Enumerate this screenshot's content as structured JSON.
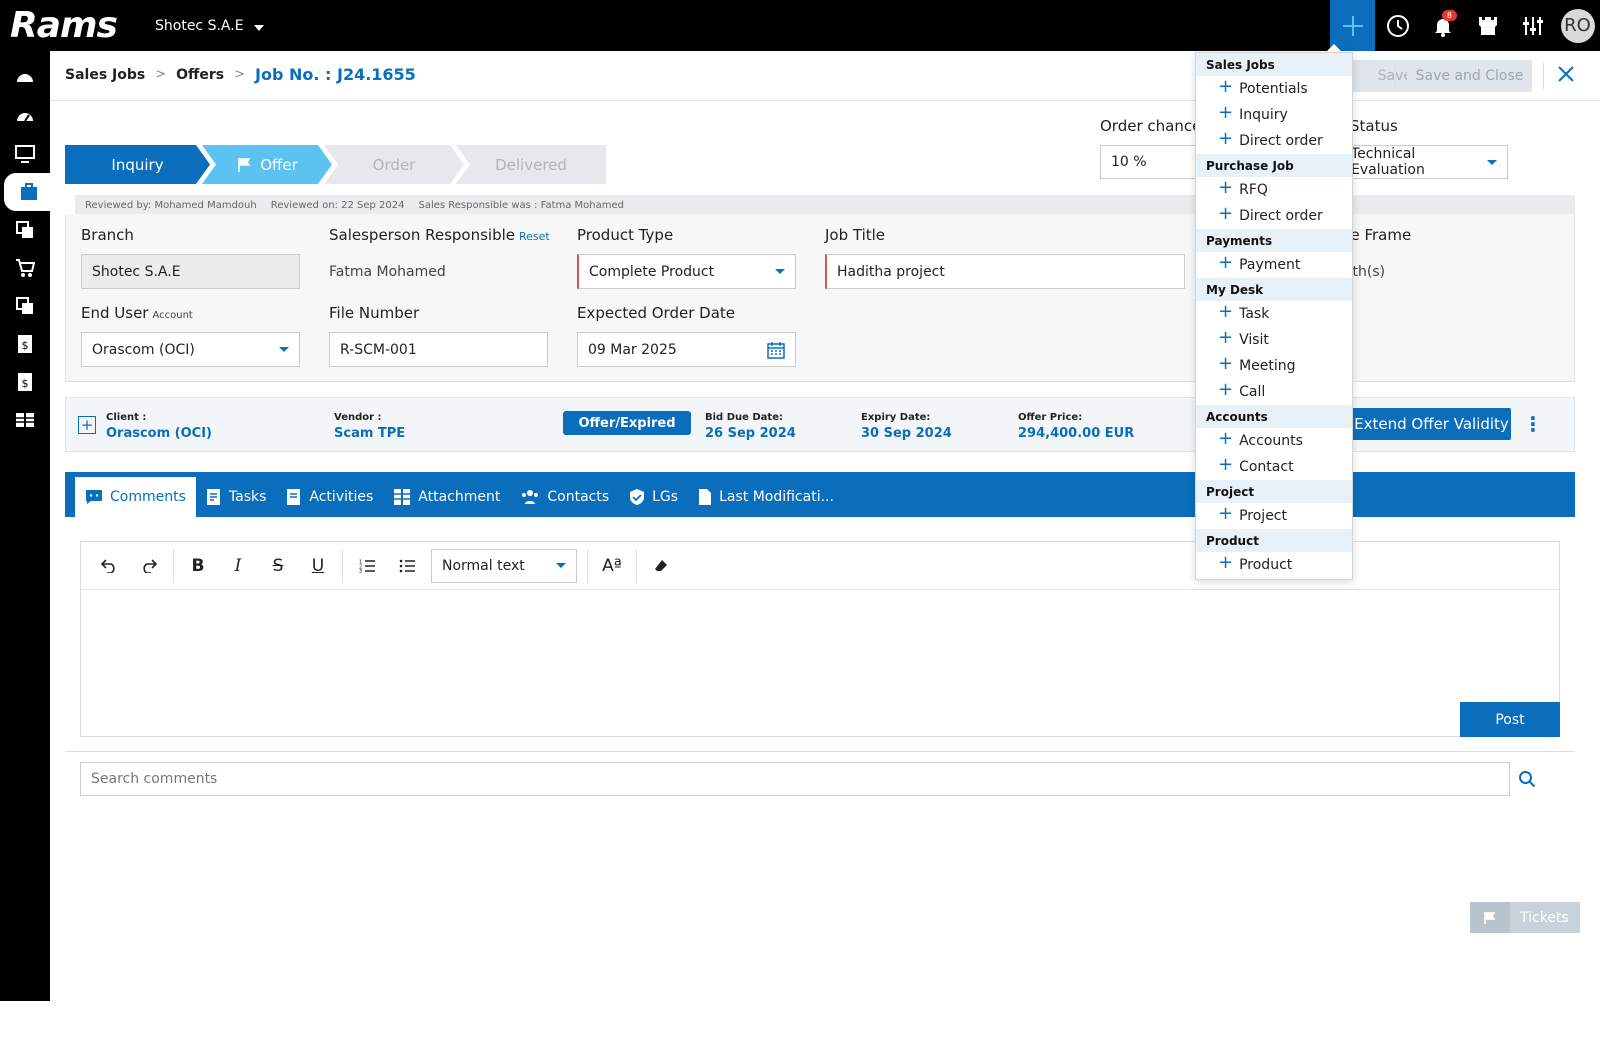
{
  "app": {
    "logo": "Rams",
    "company": "Shotec S.A.E",
    "avatar": "RO",
    "notifications_count": "8"
  },
  "breadcrumb": {
    "items": [
      "Sales Jobs",
      "Offers"
    ],
    "current": "Job No. : J24.1655"
  },
  "actions": {
    "save": "Save",
    "save_close": "Save and Close"
  },
  "steps": [
    "Inquiry",
    "Offer",
    "Order",
    "Delivered"
  ],
  "order_chance": {
    "label": "Order chance",
    "value": "10 %"
  },
  "status": {
    "label": "Status",
    "value": "Technical Evaluation"
  },
  "review": {
    "reviewed_by": "Reviewed by: Mohamed Mamdouh",
    "reviewed_on": "Reviewed on: 22 Sep 2024",
    "sales_resp": "Sales Responsible was : Fatma Mohamed"
  },
  "form": {
    "branch_label": "Branch",
    "branch_value": "Shotec S.A.E",
    "salesperson_label": "Salesperson Responsible",
    "salesperson_reset": "Reset",
    "salesperson_value": "Fatma Mohamed",
    "product_type_label": "Product Type",
    "product_type_value": "Complete Product",
    "job_title_label": "Job Title",
    "job_title_value": "Haditha project",
    "time_frame_label": "Time Frame",
    "time_frame_value": "Month(s)",
    "end_user_label": "End User",
    "end_user_sub": "Account",
    "end_user_value": "Orascom (OCI)",
    "file_number_label": "File Number",
    "file_number_value": "R-SCM-001",
    "expected_date_label": "Expected Order Date",
    "expected_date_value": "09 Mar 2025"
  },
  "summary": {
    "client_label": "Client :",
    "client_value": "Orascom (OCI)",
    "vendor_label": "Vendor :",
    "vendor_value": "Scam TPE",
    "status_pill": "Offer/Expired",
    "bid_due_label": "Bid Due Date:",
    "bid_due_value": "26 Sep 2024",
    "expiry_label": "Expiry Date:",
    "expiry_value": "30 Sep 2024",
    "price_label": "Offer Price:",
    "price_value": "294,400.00 EUR",
    "extend_button": "Extend Offer Validity"
  },
  "tabs": [
    "Comments",
    "Tasks",
    "Activities",
    "Attachment",
    "Contacts",
    "LGs",
    "Last Modificati..."
  ],
  "editor": {
    "format_select": "Normal text",
    "post_button": "Post"
  },
  "search": {
    "placeholder": "Search comments"
  },
  "tickets": {
    "label": "Tickets"
  },
  "quick_add": {
    "groups": [
      {
        "title": "Sales Jobs",
        "items": [
          "Potentials",
          "Inquiry",
          "Direct order"
        ]
      },
      {
        "title": "Purchase Job",
        "items": [
          "RFQ",
          "Direct order"
        ]
      },
      {
        "title": "Payments",
        "items": [
          "Payment"
        ]
      },
      {
        "title": "My Desk",
        "items": [
          "Task",
          "Visit",
          "Meeting",
          "Call"
        ]
      },
      {
        "title": "Accounts",
        "items": [
          "Accounts",
          "Contact"
        ]
      },
      {
        "title": "Project",
        "items": [
          "Project"
        ]
      },
      {
        "title": "Product",
        "items": [
          "Product"
        ]
      }
    ]
  },
  "colors": {
    "accent": "#0a6ebd",
    "step_active": "#5cc2f2",
    "topbar": "#000000"
  }
}
